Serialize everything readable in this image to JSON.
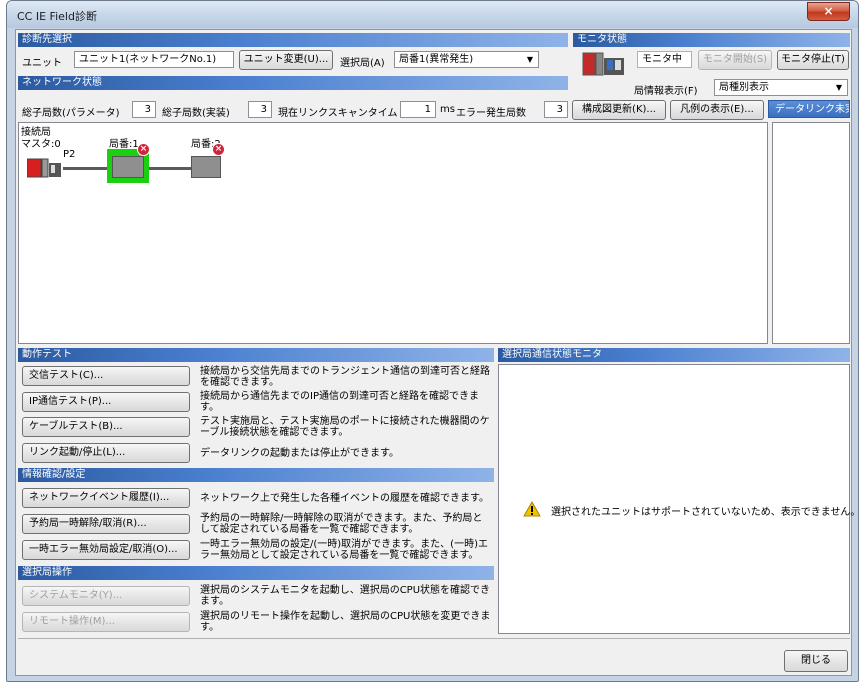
{
  "window": {
    "title": "CC IE Field診断",
    "close_glyph": "×"
  },
  "diag_target": {
    "header": "診断先選択",
    "unit_label": "ユニット",
    "unit_value": "ユニット1(ネットワークNo.1)",
    "change_unit_button": "ユニット変更(U)...",
    "station_label": "選択局(A)",
    "station_value": "局番1(異常発生)"
  },
  "monitor": {
    "header": "モニタ状態",
    "status": "モニタ中",
    "start_button": "モニタ開始(S)",
    "stop_button": "モニタ停止(T)",
    "info_label": "局情報表示(F)",
    "info_value": "局種別表示"
  },
  "network_status": {
    "header": "ネットワーク状態",
    "total_param_label": "総子局数(パラメータ)",
    "total_param_value": "3",
    "total_actual_label": "総子局数(実装)",
    "total_actual_value": "3",
    "scan_label": "現在リンクスキャンタイム",
    "scan_value": "1",
    "scan_unit": "ms",
    "error_label": "エラー発生局数",
    "error_value": "3",
    "refresh_button": "構成図更新(K)...",
    "legend_button": "凡例の表示(E)...",
    "datalink_tab": "データリンク未実"
  },
  "topology": {
    "connected_label": "接続局",
    "master_label": "マスタ:0",
    "port_label": "P2",
    "station1_label": "局番:1",
    "station2_label": "局番:2"
  },
  "operation_test": {
    "header": "動作テスト",
    "items": [
      {
        "button": "交信テスト(C)...",
        "desc": "接続局から交信先局までのトランジェント通信の到達可否と経路を確認できます。"
      },
      {
        "button": "IP通信テスト(P)...",
        "desc": "接続局から通信先までのIP通信の到達可否と経路を確認できます。"
      },
      {
        "button": "ケーブルテスト(B)...",
        "desc": "テスト実施局と、テスト実施局のポートに接続された機器間のケーブル接続状態を確認できます。"
      },
      {
        "button": "リンク起動/停止(L)...",
        "desc": "データリンクの起動または停止ができます。"
      }
    ]
  },
  "info_confirm": {
    "header": "情報確認/設定",
    "items": [
      {
        "button": "ネットワークイベント履歴(I)...",
        "desc": "ネットワーク上で発生した各種イベントの履歴を確認できます。"
      },
      {
        "button": "予約局一時解除/取消(R)...",
        "desc": "予約局の一時解除/一時解除の取消ができます。また、予約局として設定されている局番を一覧で確認できます。"
      },
      {
        "button": "一時エラー無効局設定/取消(O)...",
        "desc": "一時エラー無効局の設定/(一時)取消ができます。また、(一時)エラー無効局として設定されている局番を一覧で確認できます。"
      }
    ]
  },
  "station_ops": {
    "header": "選択局操作",
    "items": [
      {
        "button": "システムモニタ(Y)...",
        "desc": "選択局のシステムモニタを起動し、選択局のCPU状態を確認できます。"
      },
      {
        "button": "リモート操作(M)...",
        "desc": "選択局のリモート操作を起動し、選択局のCPU状態を変更できます。"
      }
    ]
  },
  "comm_monitor": {
    "header": "選択局通信状態モニタ",
    "message": "選択されたユニットはサポートされていないため、表示できません。"
  },
  "footer": {
    "close_button": "閉じる"
  },
  "colors": {
    "section_bar": "#2c5aa0",
    "selected_station": "#1bd10f",
    "error": "#d0263d",
    "warning": "#f2c400"
  }
}
